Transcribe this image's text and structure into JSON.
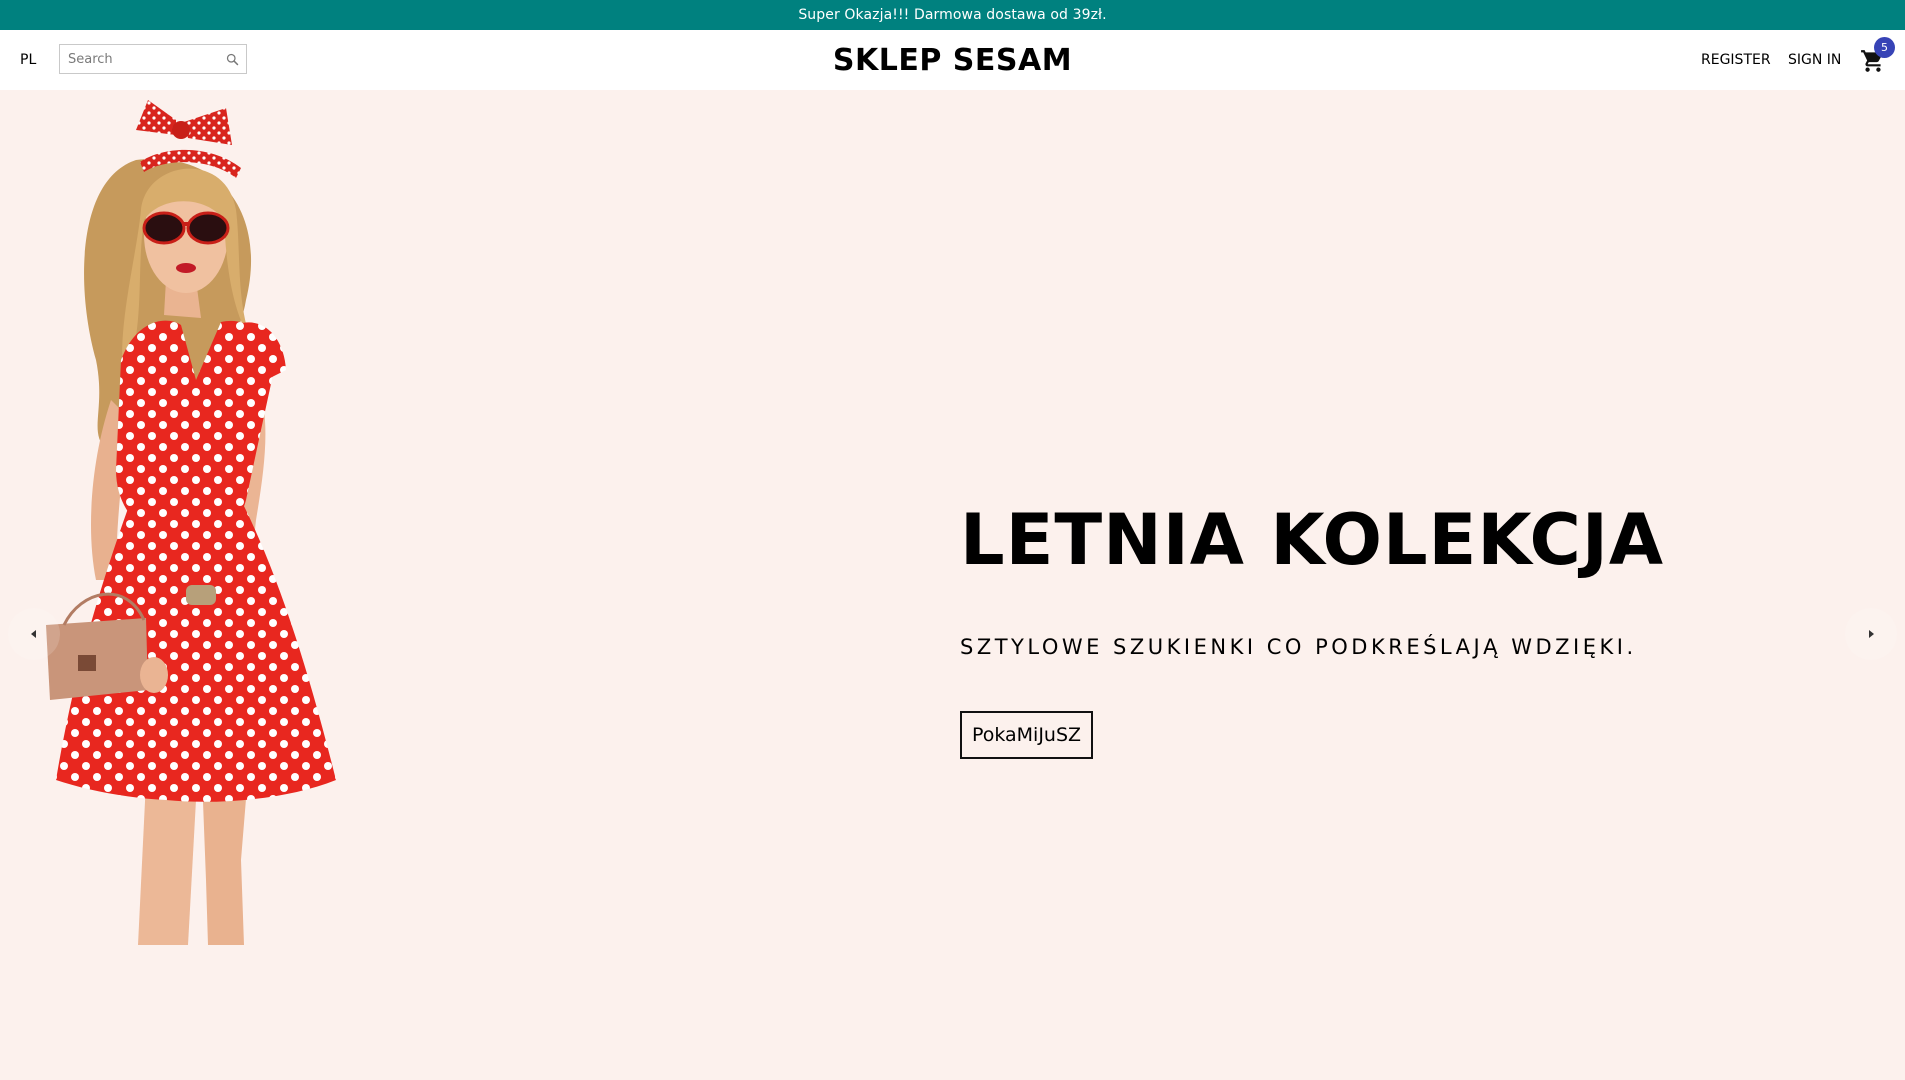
{
  "promo_bar": {
    "text": "Super Okazja!!! Darmowa dostawa od 39zł."
  },
  "header": {
    "language": "PL",
    "search": {
      "placeholder": "Search",
      "value": ""
    },
    "logo": "SKLEP SESAM",
    "register_label": "REGISTER",
    "signin_label": "SIGN IN",
    "cart_count": "5"
  },
  "hero": {
    "title": "LETNIA KOLEKCJA",
    "subtitle": "SZTYLOWE SZUKIENKI CO PODKREŚLAJĄ WDZIĘKI.",
    "button_label": "PokaMiJuSZ",
    "image": "model-in-red-polka-dot-dress"
  },
  "icons": {
    "search": "search-icon",
    "cart": "cart-icon",
    "prev": "chevron-left-icon",
    "next": "chevron-right-icon"
  },
  "colors": {
    "promo_bar": "#00817f",
    "hero_background": "#fcf1ed",
    "cart_badge": "#3743b6",
    "dress_red": "#e8271f"
  }
}
